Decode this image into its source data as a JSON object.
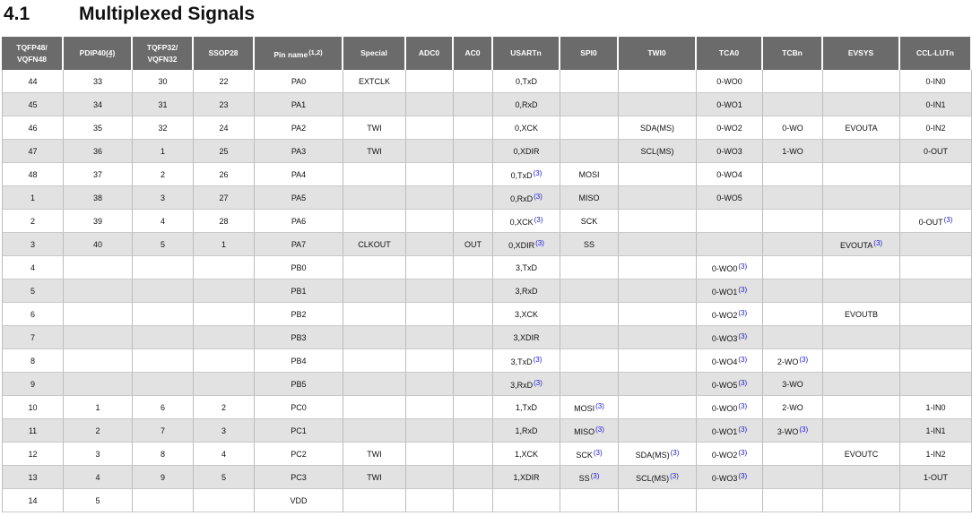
{
  "section": {
    "number": "4.1",
    "title": "Multiplexed Signals"
  },
  "columns": [
    {
      "label": "TQFP48/",
      "label2": "VQFN48"
    },
    {
      "label": "PDIP40",
      "ref": "(4)"
    },
    {
      "label": "TQFP32/",
      "label2": "VQFN32"
    },
    {
      "label": "SSOP28"
    },
    {
      "label": "Pin name",
      "sup": "(1,2)"
    },
    {
      "label": "Special"
    },
    {
      "label": "ADC0"
    },
    {
      "label": "AC0"
    },
    {
      "label": "USARTn"
    },
    {
      "label": "SPI0"
    },
    {
      "label": "TWI0"
    },
    {
      "label": "TCA0"
    },
    {
      "label": "TCBn"
    },
    {
      "label": "EVSYS"
    },
    {
      "label": "CCL-LUTn"
    }
  ],
  "rows": [
    [
      "44",
      "33",
      "30",
      "22",
      "PA0",
      "EXTCLK",
      "",
      "",
      "0,TxD",
      "",
      "",
      "0-WO0",
      "",
      "",
      "0-IN0"
    ],
    [
      "45",
      "34",
      "31",
      "23",
      "PA1",
      "",
      "",
      "",
      "0,RxD",
      "",
      "",
      "0-WO1",
      "",
      "",
      "0-IN1"
    ],
    [
      "46",
      "35",
      "32",
      "24",
      "PA2",
      "TWI",
      "",
      "",
      "0,XCK",
      "",
      "SDA(MS)",
      "0-WO2",
      "0-WO",
      "EVOUTA",
      "0-IN2"
    ],
    [
      "47",
      "36",
      "1",
      "25",
      "PA3",
      "TWI",
      "",
      "",
      "0,XDIR",
      "",
      "SCL(MS)",
      "0-WO3",
      "1-WO",
      "",
      "0-OUT"
    ],
    [
      "48",
      "37",
      "2",
      "26",
      "PA4",
      "",
      "",
      "",
      "0,TxD|(3)",
      "MOSI",
      "",
      "0-WO4",
      "",
      "",
      ""
    ],
    [
      "1",
      "38",
      "3",
      "27",
      "PA5",
      "",
      "",
      "",
      "0,RxD|(3)",
      "MISO",
      "",
      "0-WO5",
      "",
      "",
      ""
    ],
    [
      "2",
      "39",
      "4",
      "28",
      "PA6",
      "",
      "",
      "",
      "0,XCK|(3)",
      "SCK",
      "",
      "",
      "",
      "",
      "0-OUT|(3)"
    ],
    [
      "3",
      "40",
      "5",
      "1",
      "PA7",
      "CLKOUT",
      "",
      "OUT",
      "0,XDIR|(3)",
      "SS",
      "",
      "",
      "",
      "EVOUTA|(3)",
      ""
    ],
    [
      "4",
      "",
      "",
      "",
      "PB0",
      "",
      "",
      "",
      "3,TxD",
      "",
      "",
      "0-WO0|(3)",
      "",
      "",
      ""
    ],
    [
      "5",
      "",
      "",
      "",
      "PB1",
      "",
      "",
      "",
      "3,RxD",
      "",
      "",
      "0-WO1|(3)",
      "",
      "",
      ""
    ],
    [
      "6",
      "",
      "",
      "",
      "PB2",
      "",
      "",
      "",
      "3,XCK",
      "",
      "",
      "0-WO2|(3)",
      "",
      "EVOUTB",
      ""
    ],
    [
      "7",
      "",
      "",
      "",
      "PB3",
      "",
      "",
      "",
      "3,XDIR",
      "",
      "",
      "0-WO3|(3)",
      "",
      "",
      ""
    ],
    [
      "8",
      "",
      "",
      "",
      "PB4",
      "",
      "",
      "",
      "3,TxD|(3)",
      "",
      "",
      "0-WO4|(3)",
      "2-WO|(3)",
      "",
      ""
    ],
    [
      "9",
      "",
      "",
      "",
      "PB5",
      "",
      "",
      "",
      "3,RxD|(3)",
      "",
      "",
      "0-WO5|(3)",
      "3-WO",
      "",
      ""
    ],
    [
      "10",
      "1",
      "6",
      "2",
      "PC0",
      "",
      "",
      "",
      "1,TxD",
      "MOSI|(3)",
      "",
      "0-WO0|(3)",
      "2-WO",
      "",
      "1-IN0"
    ],
    [
      "11",
      "2",
      "7",
      "3",
      "PC1",
      "",
      "",
      "",
      "1,RxD",
      "MISO|(3)",
      "",
      "0-WO1|(3)",
      "3-WO|(3)",
      "",
      "1-IN1"
    ],
    [
      "12",
      "3",
      "8",
      "4",
      "PC2",
      "TWI",
      "",
      "",
      "1,XCK",
      "SCK|(3)",
      "SDA(MS)|(3)",
      "0-WO2|(3)",
      "",
      "EVOUTC",
      "1-IN2"
    ],
    [
      "13",
      "4",
      "9",
      "5",
      "PC3",
      "TWI",
      "",
      "",
      "1,XDIR",
      "SS|(3)",
      "SCL(MS)|(3)",
      "0-WO3|(3)",
      "",
      "",
      "1-OUT"
    ],
    [
      "14",
      "5",
      "",
      "",
      "VDD",
      "",
      "",
      "",
      "",
      "",
      "",
      "",
      "",
      "",
      ""
    ]
  ]
}
